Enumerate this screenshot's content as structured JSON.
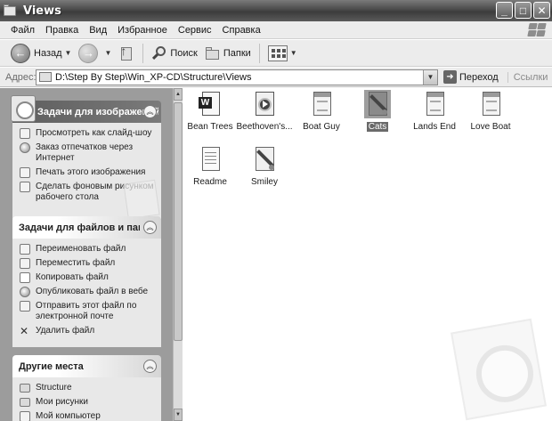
{
  "window": {
    "title": "Views"
  },
  "menu": [
    "Файл",
    "Правка",
    "Вид",
    "Избранное",
    "Сервис",
    "Справка"
  ],
  "toolbar": {
    "back_label": "Назад",
    "search_label": "Поиск",
    "folders_label": "Папки"
  },
  "address": {
    "label": "Адрес:",
    "value": "D:\\Step By Step\\Win_XP-CD\\Structure\\Views",
    "go_label": "Переход",
    "links_label": "Ссылки"
  },
  "panels": {
    "image_tasks": {
      "title": "Задачи для изображений",
      "items": [
        "Просмотреть как слайд-шоу",
        "Заказ отпечатков через Интернет",
        "Печать этого изображения",
        "Сделать фоновым рисунком рабочего стола"
      ]
    },
    "file_tasks": {
      "title": "Задачи для файлов и папок",
      "items": [
        "Переименовать файл",
        "Переместить файл",
        "Копировать файл",
        "Опубликовать файл в вебе",
        "Отправить этот файл по электронной почте",
        "Удалить файл"
      ]
    },
    "other_places": {
      "title": "Другие места",
      "items": [
        "Structure",
        "Мои рисунки",
        "Мой компьютер"
      ]
    }
  },
  "files": [
    {
      "name": "Bean Trees",
      "icon": "word-document-icon"
    },
    {
      "name": "Beethoven's...",
      "icon": "media-file-icon"
    },
    {
      "name": "Boat Guy",
      "icon": "image-document-icon"
    },
    {
      "name": "Cats",
      "icon": "paint-image-icon",
      "selected": true
    },
    {
      "name": "Lands End",
      "icon": "image-document-icon"
    },
    {
      "name": "Love Boat",
      "icon": "image-document-icon"
    },
    {
      "name": "Readme",
      "icon": "text-document-icon"
    },
    {
      "name": "Smiley",
      "icon": "paint-image-icon"
    }
  ]
}
